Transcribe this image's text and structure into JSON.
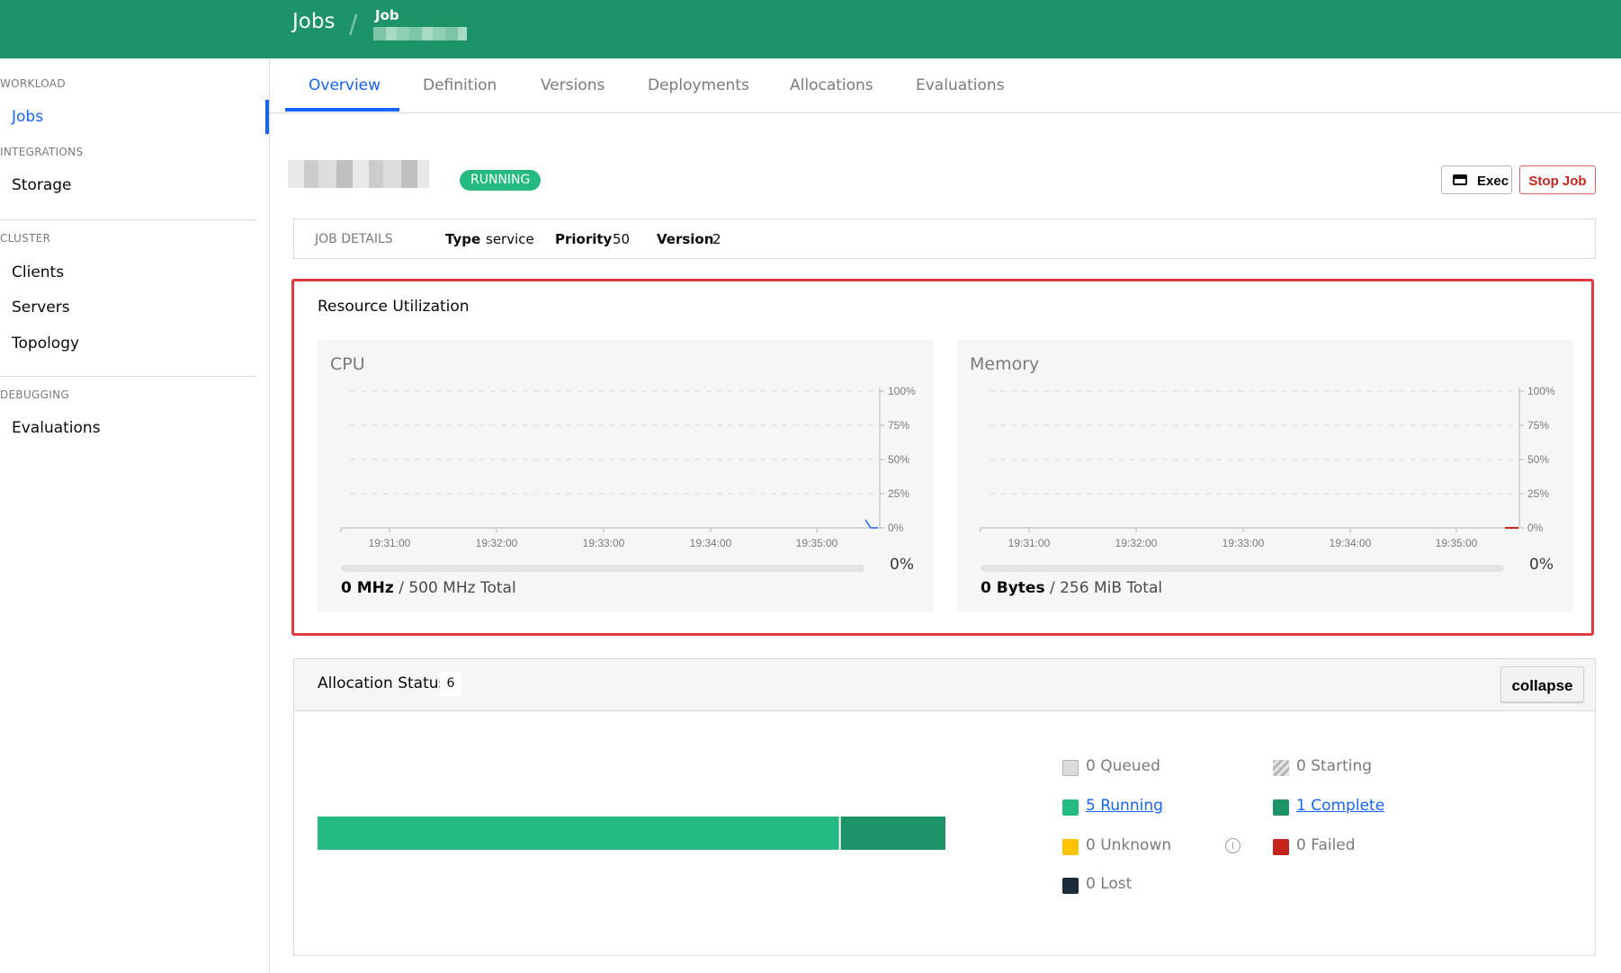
{
  "header": {
    "breadcrumb_root": "Jobs",
    "breadcrumb_separator": "/",
    "breadcrumb_job_label": "Job"
  },
  "sidebar": {
    "sections": [
      {
        "title": "WORKLOAD",
        "items": [
          "Jobs"
        ]
      },
      {
        "title": "INTEGRATIONS",
        "items": [
          "Storage"
        ]
      },
      {
        "title": "CLUSTER",
        "items": [
          "Clients",
          "Servers",
          "Topology"
        ]
      },
      {
        "title": "DEBUGGING",
        "items": [
          "Evaluations"
        ]
      }
    ],
    "active_item": "Jobs"
  },
  "tabs": [
    "Overview",
    "Definition",
    "Versions",
    "Deployments",
    "Allocations",
    "Evaluations"
  ],
  "active_tab": "Overview",
  "job": {
    "status": "RUNNING",
    "exec_label": "Exec",
    "stop_label": "Stop Job"
  },
  "job_details": {
    "title": "JOB DETAILS",
    "type_label": "Type",
    "type_value": "service",
    "priority_label": "Priority",
    "priority_value": "50",
    "version_label": "Version",
    "version_value": "2"
  },
  "resource_utilization": {
    "title": "Resource Utilization",
    "cpu": {
      "title": "CPU",
      "percent": "0%",
      "used": "0 MHz",
      "total_text": " / 500 MHz Total"
    },
    "memory": {
      "title": "Memory",
      "percent": "0%",
      "used": "0 Bytes",
      "total_text": " / 256 MiB Total"
    }
  },
  "chart_data": [
    {
      "type": "line",
      "title": "CPU",
      "x_ticks": [
        "19:31:00",
        "19:32:00",
        "19:33:00",
        "19:34:00",
        "19:35:00"
      ],
      "y_ticks": [
        "100%",
        "75%",
        "50%",
        "25%",
        "0%"
      ],
      "ylim": [
        0,
        100
      ],
      "grid": true,
      "series": [
        {
          "values": [
            0
          ],
          "color": "#1563ff"
        }
      ]
    },
    {
      "type": "line",
      "title": "Memory",
      "x_ticks": [
        "19:31:00",
        "19:32:00",
        "19:33:00",
        "19:34:00",
        "19:35:00"
      ],
      "y_ticks": [
        "100%",
        "75%",
        "50%",
        "25%",
        "0%"
      ],
      "ylim": [
        0,
        100
      ],
      "grid": true,
      "series": [
        {
          "values": [
            0
          ],
          "color": "#c5251c"
        }
      ]
    }
  ],
  "allocation_status": {
    "title": "Allocation Status",
    "count": "6",
    "collapse_label": "collapse",
    "bar": [
      {
        "name": "running",
        "value": 5,
        "color": "#25ba81"
      },
      {
        "name": "complete",
        "value": 1,
        "color": "#1d9467"
      }
    ],
    "legend": {
      "queued": "0 Queued",
      "starting": "0 Starting",
      "running": "5 Running",
      "complete": "1 Complete",
      "unknown": "0 Unknown",
      "failed": "0 Failed",
      "lost": "0 Lost"
    },
    "colors": {
      "queued": "#dbdbdb",
      "running": "#25ba81",
      "complete": "#1d9467",
      "unknown": "#ffc300",
      "failed": "#c5251c",
      "lost": "#1c2b3a"
    }
  }
}
